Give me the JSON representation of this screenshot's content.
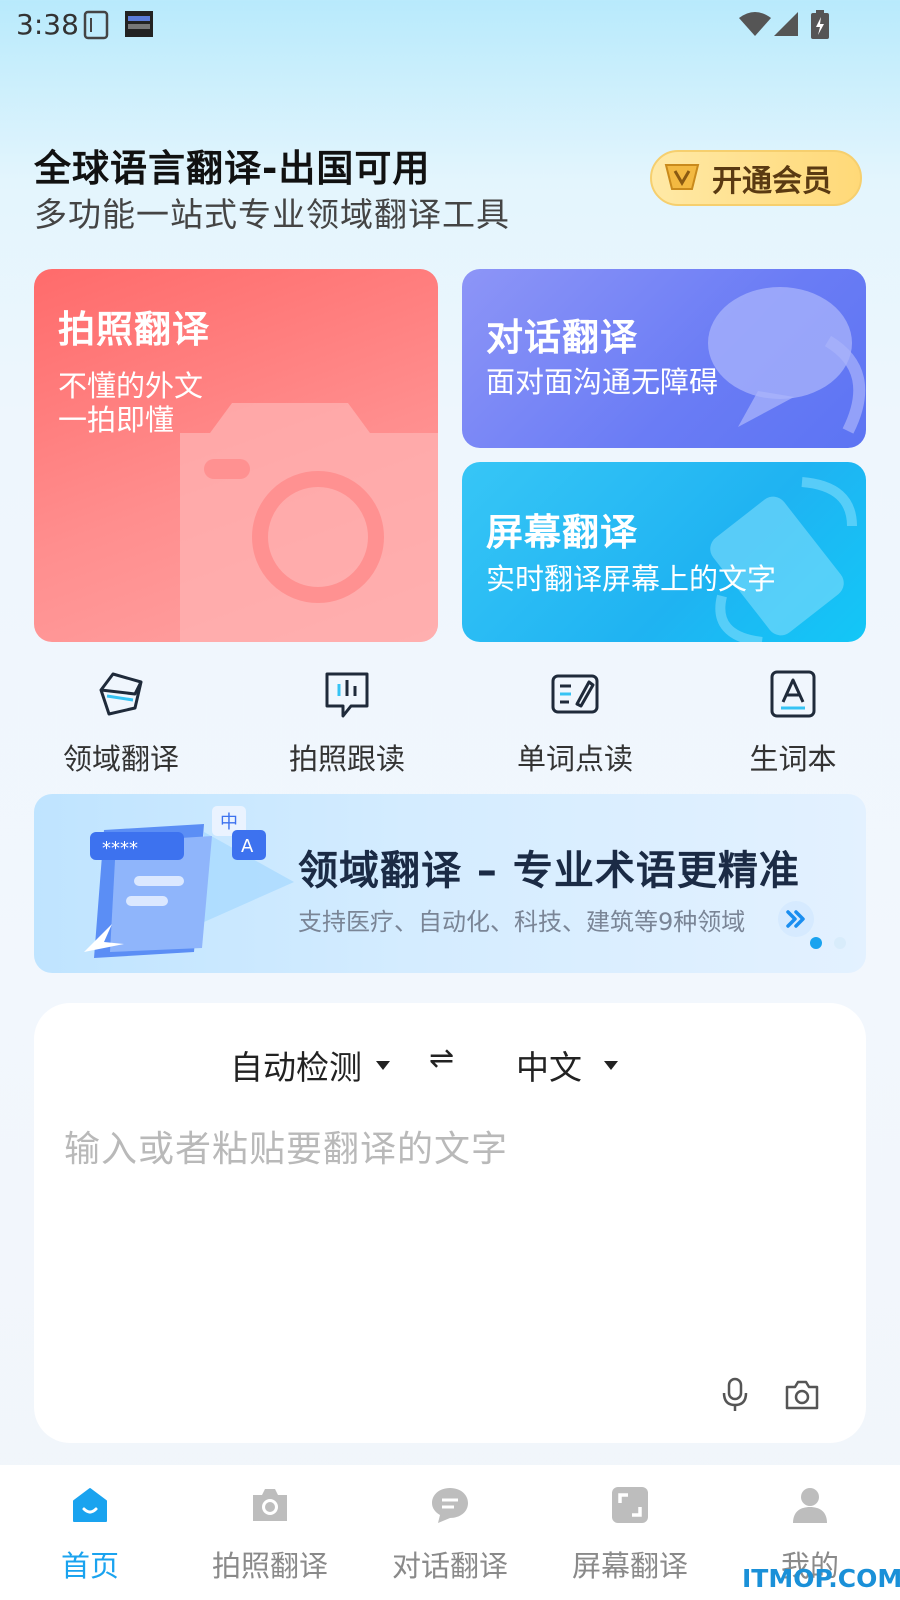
{
  "status_bar": {
    "time": "3:38"
  },
  "header": {
    "title": "全球语言翻译-出国可用",
    "subtitle": "多功能一站式专业领域翻译工具",
    "vip_button": "开通会员"
  },
  "cards": {
    "photo": {
      "title": "拍照翻译",
      "subtitle_line1": "不懂的外文",
      "subtitle_line2": "一拍即懂"
    },
    "dialog": {
      "title": "对话翻译",
      "subtitle": "面对面沟通无障碍"
    },
    "screen": {
      "title": "屏幕翻译",
      "subtitle": "实时翻译屏幕上的文字"
    }
  },
  "tools": [
    {
      "label": "领域翻译",
      "icon": "domain-translate-icon"
    },
    {
      "label": "拍照跟读",
      "icon": "photo-read-icon"
    },
    {
      "label": "单词点读",
      "icon": "word-read-icon"
    },
    {
      "label": "生词本",
      "icon": "vocabulary-book-icon"
    }
  ],
  "banner": {
    "title": "领域翻译 – 专业术语更精准",
    "subtitle": "支持医疗、自动化、科技、建筑等9种领域",
    "illustration_label_zh": "中",
    "illustration_label_en": "A",
    "illustration_stars": "****",
    "active_slide": 1,
    "slide_count": 2
  },
  "translate": {
    "source_lang": "自动检测",
    "swap_symbol": "⇌",
    "target_lang": "中文",
    "placeholder": "输入或者粘贴要翻译的文字"
  },
  "bottom_nav": [
    {
      "label": "首页",
      "icon": "home-icon",
      "active": true
    },
    {
      "label": "拍照翻译",
      "icon": "camera-icon",
      "active": false
    },
    {
      "label": "对话翻译",
      "icon": "chat-icon",
      "active": false
    },
    {
      "label": "屏幕翻译",
      "icon": "screen-icon",
      "active": false
    },
    {
      "label": "我的",
      "icon": "profile-icon",
      "active": false
    }
  ],
  "watermark": "ITMOP.COM",
  "colors": {
    "accent": "#1aa3ef",
    "photo_card": "#ff7a7a",
    "dialog_card": "#6f7ff5",
    "screen_card": "#25bdf4",
    "vip": "#ffd978"
  }
}
